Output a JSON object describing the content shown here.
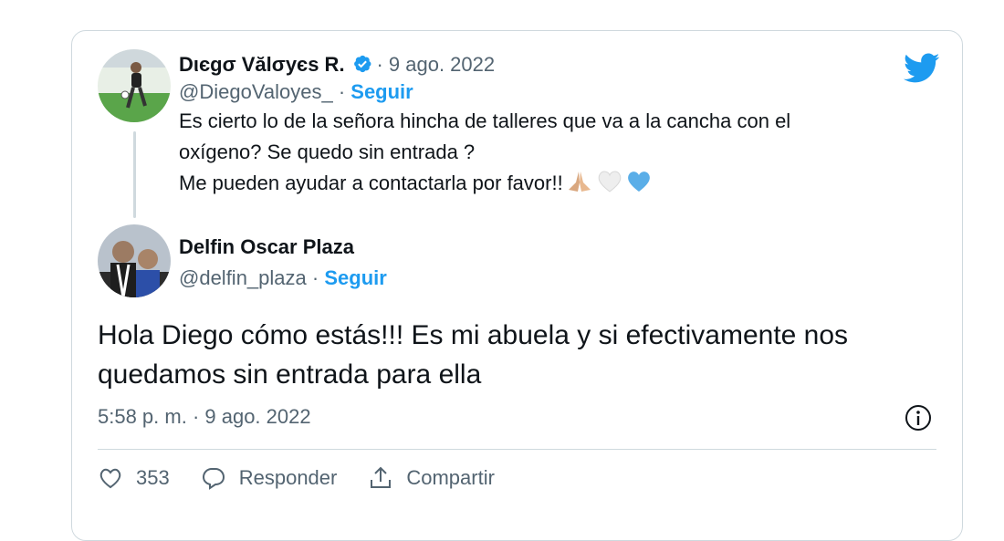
{
  "parent_tweet": {
    "author_name": "Dιєgσ Vălσуєѕ R.",
    "date": "· 9 ago. 2022",
    "handle": "@DiegoValoyes_",
    "separator": "·",
    "follow_label": "Seguir",
    "text_lines": [
      "Es cierto lo de la señora hincha de talleres que va a la cancha con el",
      "oxígeno? Se quedo sin entrada ?",
      "Me pueden ayudar a contactarla por favor!!"
    ]
  },
  "reply_tweet": {
    "author_name": "Delfin Oscar Plaza",
    "handle": "@delfin_plaza",
    "separator": "·",
    "follow_label": "Seguir",
    "text": "Hola Diego cómo estás!!! Es mi abuela y si efectivamente nos quedamos sin entrada para ella",
    "timestamp": "5:58 p. m. · 9 ago. 2022"
  },
  "actions": {
    "like_count": "353",
    "reply_label": "Responder",
    "share_label": "Compartir"
  },
  "colors": {
    "accent": "#1d9bf0",
    "secondary_text": "#536471",
    "border": "#cfd9de"
  },
  "icons": [
    "twitter-bird-icon",
    "verified-badge-icon",
    "info-icon",
    "heart-icon",
    "reply-icon",
    "share-icon",
    "praying-hands-emoji",
    "white-heart-emoji",
    "blue-heart-emoji"
  ]
}
